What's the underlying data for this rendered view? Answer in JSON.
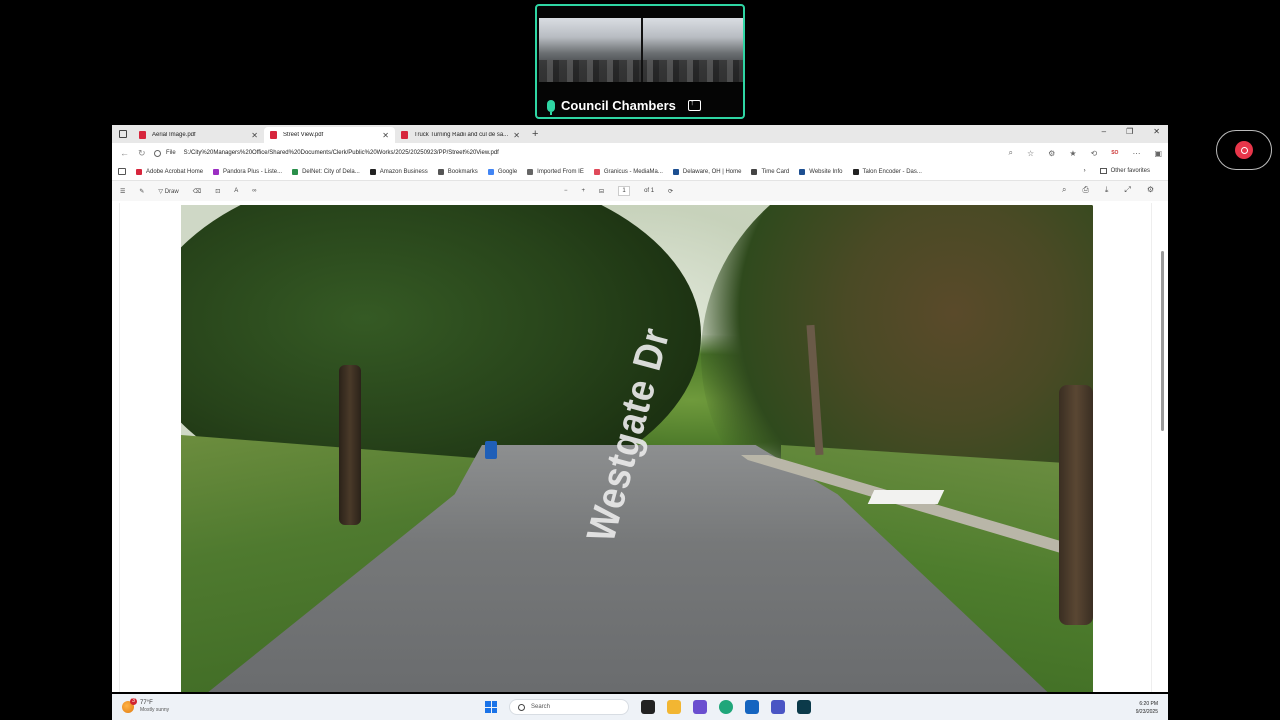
{
  "meeting": {
    "tile_label": "Council Chambers"
  },
  "browser": {
    "tabs": [
      {
        "title": "Aerial Image.pdf",
        "active": false
      },
      {
        "title": "Street View.pdf",
        "active": true
      },
      {
        "title": "Truck Turning Radii and cul de sa...",
        "active": false
      }
    ],
    "address": {
      "scheme_label": "File",
      "url": "S:/City%20Managers%20Office/Shared%20Documents/Clerk/Public%20Works/2025/20250923/PP/Street%20View.pdf",
      "profile_badge": "SO"
    },
    "bookmarks": [
      {
        "label": "Adobe Acrobat Home",
        "color": "#d7263d"
      },
      {
        "label": "Pandora Plus - Liste...",
        "color": "#9b2ec2"
      },
      {
        "label": "DelNet: City of Dela...",
        "color": "#2a8f4a"
      },
      {
        "label": "Amazon Business",
        "color": "#222222"
      },
      {
        "label": "Bookmarks",
        "color": "#555555"
      },
      {
        "label": "Google",
        "color": "#4285f4"
      },
      {
        "label": "Imported From IE",
        "color": "#666666"
      },
      {
        "label": "Granicus - MediaMa...",
        "color": "#e04a5a"
      },
      {
        "label": "Delaware, OH | Home",
        "color": "#1d4f91"
      },
      {
        "label": "Time Card",
        "color": "#444444"
      },
      {
        "label": "Website Info",
        "color": "#1d4f91"
      },
      {
        "label": "Talon Encoder - Das...",
        "color": "#222222"
      }
    ],
    "other_favorites": "Other favorites"
  },
  "pdf_toolbar": {
    "draw_label": "Draw",
    "page_current": "1",
    "page_total": "of 1"
  },
  "pdf": {
    "street_sign_text": "Westgate Dr"
  },
  "taskbar": {
    "weather_badge": "3",
    "temperature": "77°F",
    "condition": "Mostly sunny",
    "search_placeholder": "Search",
    "time": "6:20 PM",
    "date": "9/23/2025"
  }
}
